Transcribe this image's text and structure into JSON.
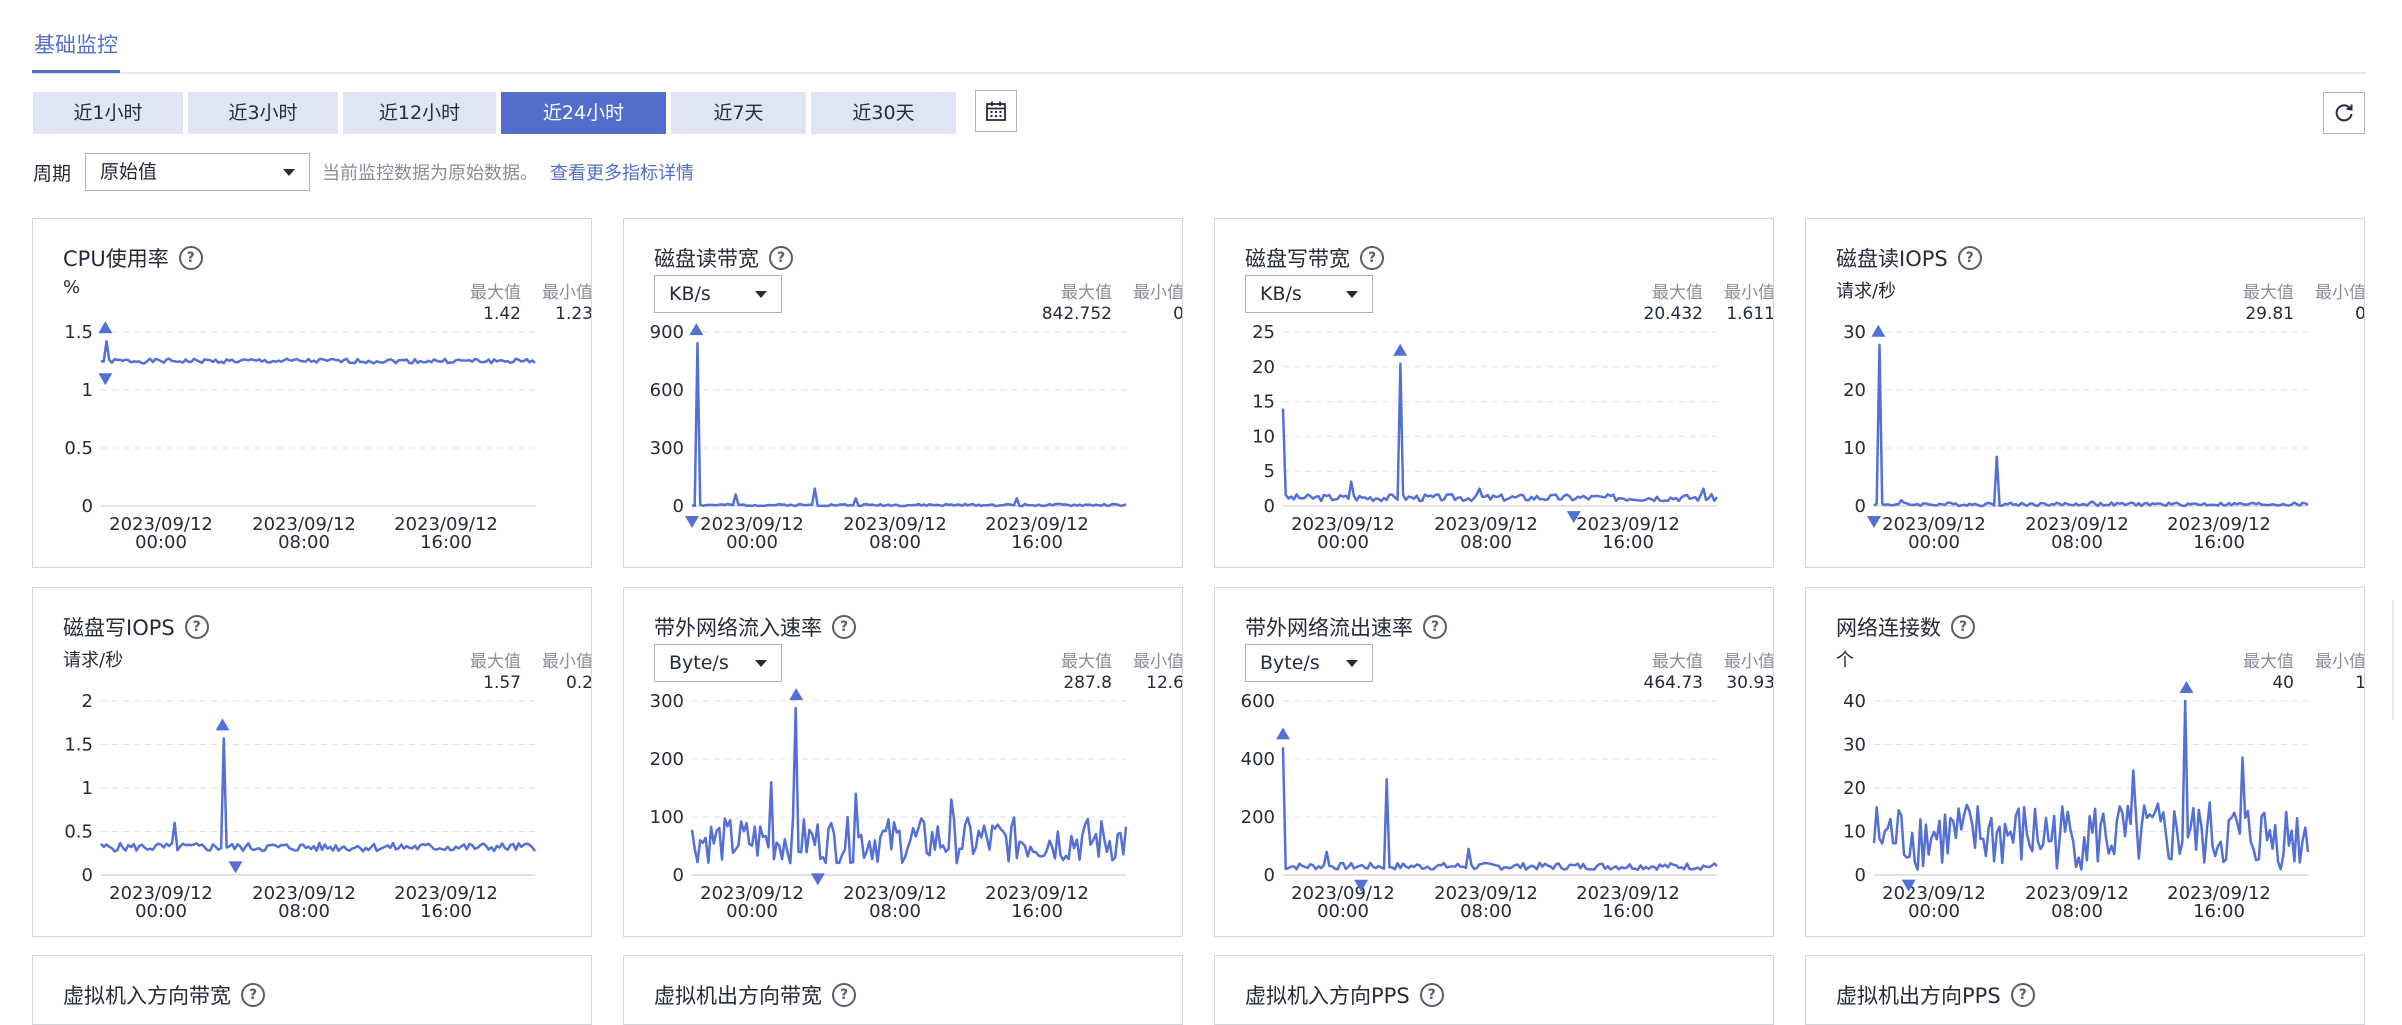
{
  "tabs": {
    "active": "基础监控"
  },
  "time_ranges": [
    {
      "label": "近1小时",
      "active": false
    },
    {
      "label": "近3小时",
      "active": false
    },
    {
      "label": "近12小时",
      "active": false
    },
    {
      "label": "近24小时",
      "active": true
    },
    {
      "label": "近7天",
      "active": false
    },
    {
      "label": "近30天",
      "active": false
    }
  ],
  "period": {
    "label": "周期",
    "value": "原始值",
    "note": "当前监控数据为原始数据。",
    "link": "查看更多指标详情"
  },
  "stats_labels": {
    "max": "最大值",
    "min": "最小值"
  },
  "colors": {
    "accent": "#526ecc",
    "line": "#5470d6",
    "grid": "#dfe1e6"
  },
  "x_ticks": [
    {
      "date": "2023/09/12",
      "time": "00:00"
    },
    {
      "date": "2023/09/12",
      "time": "08:00"
    },
    {
      "date": "2023/09/12",
      "time": "16:00"
    }
  ],
  "cards": [
    {
      "title": "CPU使用率",
      "unit": "%",
      "select": null,
      "max": "1.42",
      "min": "1.23",
      "chart_data": {
        "type": "line",
        "yticks": [
          "1.5",
          "1",
          "0.5",
          "0"
        ],
        "ylim": [
          0,
          1.5
        ],
        "base": 1.25,
        "noise": 0.02,
        "spikes": [
          [
            0.01,
            1.42
          ]
        ],
        "peak_x": 0.01,
        "trough_x": 0.01,
        "seed": 1
      }
    },
    {
      "title": "磁盘读带宽",
      "unit": null,
      "select": "KB/s",
      "max": "842.752",
      "min": "0",
      "chart_data": {
        "type": "line",
        "yticks": [
          "900",
          "600",
          "300",
          "0"
        ],
        "ylim": [
          0,
          900
        ],
        "base": 5,
        "noise": 6,
        "spikes": [
          [
            0.01,
            842.752
          ],
          [
            0.1,
            60
          ],
          [
            0.28,
            90
          ],
          [
            0.38,
            40
          ],
          [
            0.75,
            40
          ]
        ],
        "peak_x": 0.01,
        "trough_x": 0.0,
        "seed": 2
      }
    },
    {
      "title": "磁盘写带宽",
      "unit": null,
      "select": "KB/s",
      "max": "20.432",
      "min": "1.611",
      "chart_data": {
        "type": "line",
        "yticks": [
          "25",
          "20",
          "15",
          "10",
          "5",
          "0"
        ],
        "ylim": [
          0,
          25
        ],
        "base": 1.2,
        "noise": 0.5,
        "spikes": [
          [
            0.0,
            14
          ],
          [
            0.27,
            20.432
          ],
          [
            0.16,
            3.5
          ],
          [
            0.45,
            2.5
          ],
          [
            0.97,
            2.5
          ]
        ],
        "peak_x": 0.27,
        "trough_x": 0.67,
        "seed": 3
      }
    },
    {
      "title": "磁盘读IOPS",
      "unit": "请求/秒",
      "select": null,
      "max": "29.81",
      "min": "0",
      "chart_data": {
        "type": "line",
        "yticks": [
          "30",
          "20",
          "10",
          "0"
        ],
        "ylim": [
          0,
          30
        ],
        "base": 0.3,
        "noise": 0.3,
        "spikes": [
          [
            0.01,
            27.8
          ],
          [
            0.28,
            8.5
          ],
          [
            0.06,
            1
          ],
          [
            0.5,
            0.8
          ]
        ],
        "peak_x": 0.01,
        "trough_x": 0.0,
        "seed": 4
      }
    },
    {
      "title": "磁盘写IOPS",
      "unit": "请求/秒",
      "select": null,
      "max": "1.57",
      "min": "0.2",
      "chart_data": {
        "type": "line",
        "yticks": [
          "2",
          "1.5",
          "1",
          "0.5",
          "0"
        ],
        "ylim": [
          0,
          2
        ],
        "base": 0.32,
        "noise": 0.05,
        "spikes": [
          [
            0.28,
            1.57
          ],
          [
            0.17,
            0.6
          ]
        ],
        "peak_x": 0.28,
        "trough_x": 0.31,
        "seed": 5
      }
    },
    {
      "title": "带外网络流入速率",
      "unit": null,
      "select": "Byte/s",
      "max": "287.8",
      "min": "12.6",
      "chart_data": {
        "type": "line",
        "yticks": [
          "300",
          "200",
          "100",
          "0"
        ],
        "ylim": [
          0,
          300
        ],
        "base": 60,
        "noise": 40,
        "spikes": [
          [
            0.24,
            287.8
          ],
          [
            0.18,
            160
          ],
          [
            0.38,
            140
          ],
          [
            0.6,
            130
          ]
        ],
        "peak_x": 0.24,
        "trough_x": 0.29,
        "seed": 6
      }
    },
    {
      "title": "带外网络流出速率",
      "unit": null,
      "select": "Byte/s",
      "max": "464.73",
      "min": "30.93",
      "chart_data": {
        "type": "line",
        "yticks": [
          "600",
          "400",
          "200",
          "0"
        ],
        "ylim": [
          0,
          600
        ],
        "base": 30,
        "noise": 12,
        "spikes": [
          [
            0.0,
            440
          ],
          [
            0.24,
            330
          ],
          [
            0.43,
            90
          ],
          [
            0.1,
            80
          ]
        ],
        "peak_x": 0.0,
        "trough_x": 0.18,
        "seed": 7
      }
    },
    {
      "title": "网络连接数",
      "unit": "个",
      "select": null,
      "max": "40",
      "min": "1",
      "chart_data": {
        "type": "line",
        "yticks": [
          "40",
          "30",
          "20",
          "10",
          "0"
        ],
        "ylim": [
          0,
          40
        ],
        "base": 9,
        "noise": 8,
        "spikes": [
          [
            0.72,
            40
          ],
          [
            0.6,
            24
          ],
          [
            0.85,
            27
          ]
        ],
        "peak_x": 0.72,
        "trough_x": 0.08,
        "seed": 8
      }
    }
  ],
  "bottom_cards": [
    {
      "title": "虚拟机入方向带宽"
    },
    {
      "title": "虚拟机出方向带宽"
    },
    {
      "title": "虚拟机入方向PPS"
    },
    {
      "title": "虚拟机出方向PPS"
    }
  ]
}
